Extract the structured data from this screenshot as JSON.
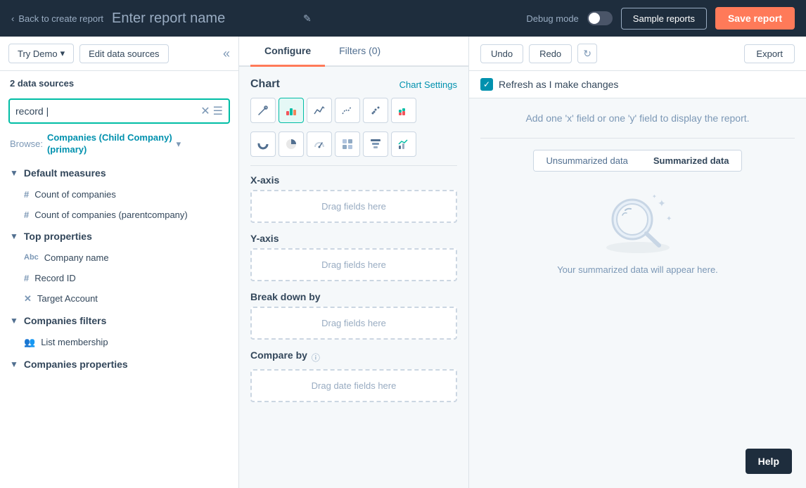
{
  "topbar": {
    "back_label": "Back to create report",
    "report_name_placeholder": "Enter report name",
    "debug_mode_label": "Debug mode",
    "sample_reports_label": "Sample reports",
    "save_report_label": "Save report"
  },
  "sidebar": {
    "try_demo_label": "Try Demo",
    "edit_sources_label": "Edit data sources",
    "data_sources_label": "2 data sources",
    "search_value": "record |",
    "browse_label": "Browse:",
    "browse_link": "Companies (Child Company)\n(primary)",
    "sections": [
      {
        "id": "default-measures",
        "label": "Default measures",
        "items": [
          {
            "icon": "#",
            "label": "Count of companies"
          },
          {
            "icon": "#",
            "label": "Count of companies (parentcompany)"
          }
        ]
      },
      {
        "id": "top-properties",
        "label": "Top properties",
        "items": [
          {
            "icon": "Abc",
            "label": "Company name"
          },
          {
            "icon": "#",
            "label": "Record ID"
          },
          {
            "icon": "✕",
            "label": "Target Account"
          }
        ]
      },
      {
        "id": "companies-filters",
        "label": "Companies filters",
        "items": [
          {
            "icon": "👥",
            "label": "List membership"
          }
        ]
      },
      {
        "id": "companies-properties",
        "label": "Companies properties",
        "items": []
      }
    ]
  },
  "configure": {
    "chart_label": "Chart",
    "chart_settings_label": "Chart Settings",
    "xaxis_label": "X-axis",
    "xaxis_placeholder": "Drag fields here",
    "yaxis_label": "Y-axis",
    "yaxis_placeholder": "Drag fields here",
    "breakdown_label": "Break down by",
    "breakdown_placeholder": "Drag fields here",
    "compareby_label": "Compare by",
    "compareby_placeholder": "Drag date fields here"
  },
  "tabs": [
    {
      "id": "configure",
      "label": "Configure"
    },
    {
      "id": "filters",
      "label": "Filters (0)"
    }
  ],
  "right_panel": {
    "undo_label": "Undo",
    "redo_label": "Redo",
    "export_label": "Export",
    "refresh_label": "Refresh as I make changes",
    "add_field_msg": "Add one 'x' field or one 'y' field to display the report.",
    "unsummarized_label": "Unsummarized data",
    "summarized_label": "Summarized data",
    "summarized_msg": "Your summarized data will appear here."
  },
  "help_label": "Help"
}
